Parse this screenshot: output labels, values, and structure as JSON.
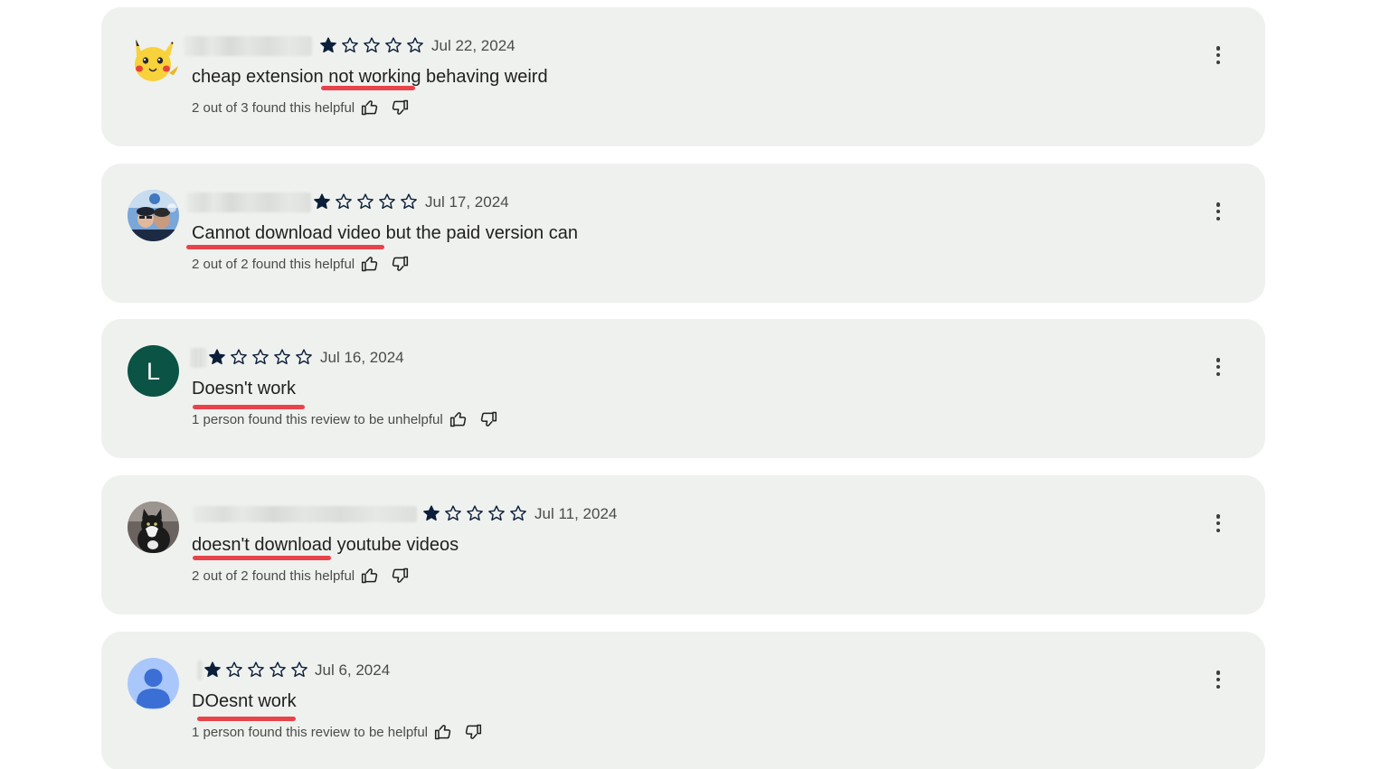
{
  "colors": {
    "card_background": "#eff1ee",
    "star_fill": "#0b1f3a",
    "underline": "#e8434b",
    "avatar_l_background": "#0b5344",
    "avatar_default_background": "#a9c7fa",
    "avatar_default_figure": "#3b6fd6"
  },
  "icons": {
    "star_filled": "star-filled-icon",
    "star_empty": "star-outline-icon",
    "thumbs_up": "thumbs-up-icon",
    "thumbs_down": "thumbs-down-icon",
    "more": "more-vert-icon"
  },
  "reviews": [
    {
      "avatar": "pikachu",
      "rating": 1,
      "max_rating": 5,
      "date": "Jul 22, 2024",
      "text": "cheap extension not working behaving weird",
      "helpful": "2 out of 3 found this helpful"
    },
    {
      "avatar": "photo-people",
      "rating": 1,
      "max_rating": 5,
      "date": "Jul 17, 2024",
      "text": "Cannot download video but the paid version can",
      "helpful": "2 out of 2 found this helpful"
    },
    {
      "avatar": "letter",
      "avatar_letter": "L",
      "rating": 1,
      "max_rating": 5,
      "date": "Jul 16, 2024",
      "text": "Doesn't work",
      "helpful": "1 person found this review to be unhelpful"
    },
    {
      "avatar": "photo-cat",
      "rating": 1,
      "max_rating": 5,
      "date": "Jul 11, 2024",
      "text": "doesn't download youtube videos",
      "helpful": "2 out of 2 found this helpful"
    },
    {
      "avatar": "default-person",
      "rating": 1,
      "max_rating": 5,
      "date": "Jul 6, 2024",
      "text": "DOesnt work",
      "helpful": "1 person found this review to be helpful"
    }
  ]
}
